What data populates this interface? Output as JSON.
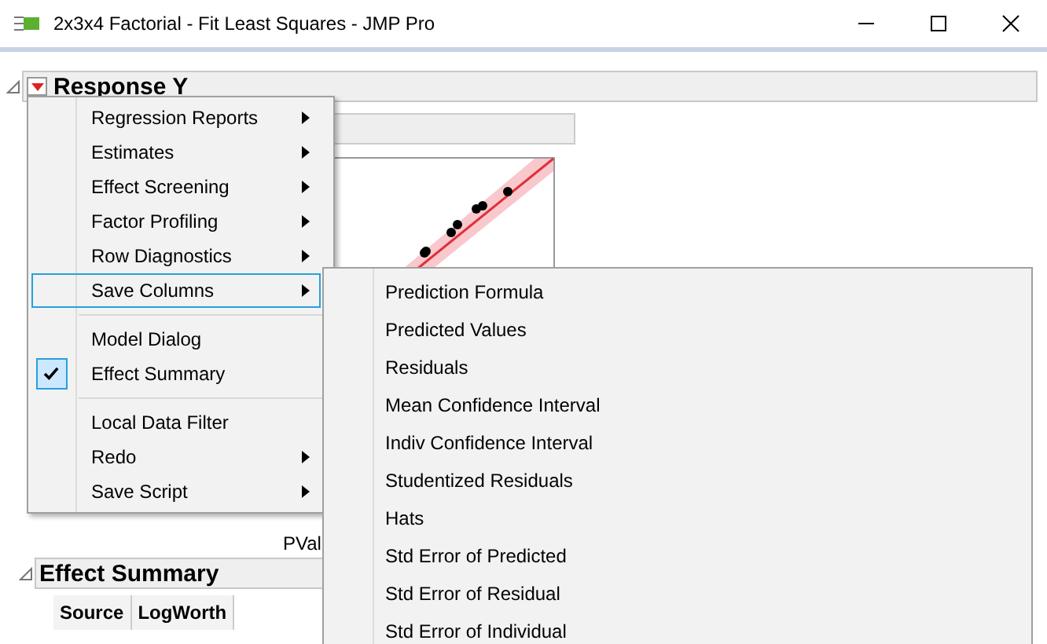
{
  "window": {
    "title": "2x3x4 Factorial - Fit Least Squares - JMP Pro"
  },
  "report": {
    "title": "Response Y",
    "expanded": true,
    "pvalue_label": "PVal",
    "effect_summary": {
      "title": "Effect Summary",
      "expanded": true,
      "columns": [
        "Source",
        "LogWorth"
      ]
    }
  },
  "menu": [
    {
      "kind": "item",
      "label": "Regression Reports",
      "submenu": true,
      "checked": false,
      "selected": false
    },
    {
      "kind": "item",
      "label": "Estimates",
      "submenu": true,
      "checked": false,
      "selected": false
    },
    {
      "kind": "item",
      "label": "Effect Screening",
      "submenu": true,
      "checked": false,
      "selected": false
    },
    {
      "kind": "item",
      "label": "Factor Profiling",
      "submenu": true,
      "checked": false,
      "selected": false
    },
    {
      "kind": "item",
      "label": "Row Diagnostics",
      "submenu": true,
      "checked": false,
      "selected": false
    },
    {
      "kind": "item",
      "label": "Save Columns",
      "submenu": true,
      "checked": false,
      "selected": true
    },
    {
      "kind": "separator"
    },
    {
      "kind": "item",
      "label": "Model Dialog",
      "submenu": false,
      "checked": false,
      "selected": false
    },
    {
      "kind": "item",
      "label": "Effect Summary",
      "submenu": false,
      "checked": true,
      "selected": false
    },
    {
      "kind": "separator"
    },
    {
      "kind": "item",
      "label": "Local Data Filter",
      "submenu": false,
      "checked": false,
      "selected": false
    },
    {
      "kind": "item",
      "label": "Redo",
      "submenu": true,
      "checked": false,
      "selected": false
    },
    {
      "kind": "item",
      "label": "Save Script",
      "submenu": true,
      "checked": false,
      "selected": false
    }
  ],
  "submenu": [
    "Prediction Formula",
    "Predicted Values",
    "Residuals",
    "Mean Confidence Interval",
    "Indiv Confidence Interval",
    "Studentized Residuals",
    "Hats",
    "Std Error of Predicted",
    "Std Error of Residual",
    "Std Error of Individual"
  ]
}
